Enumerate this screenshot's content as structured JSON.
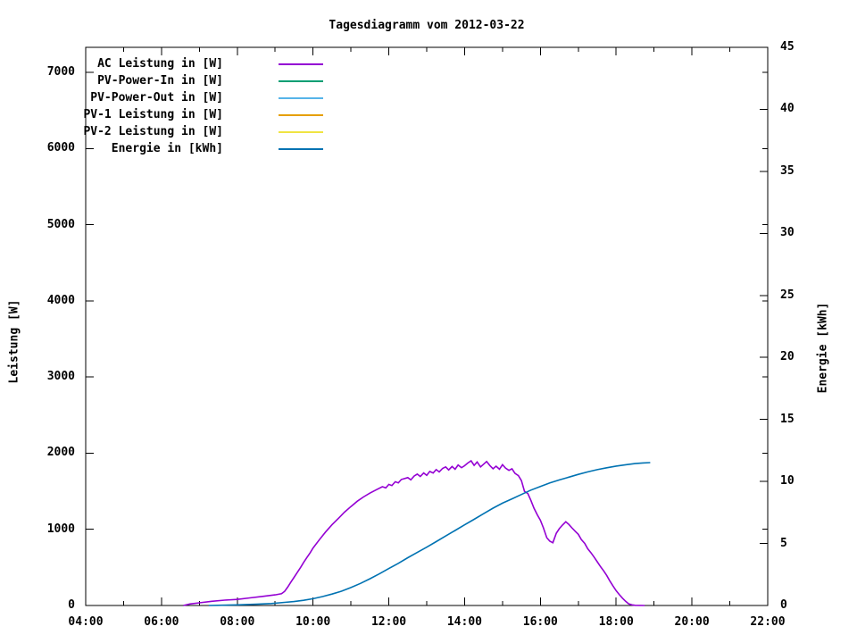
{
  "title": "Tagesdiagramm vom 2012-03-22",
  "axes": {
    "left": {
      "label": "Leistung [W]",
      "tick_values": [
        0,
        1000,
        2000,
        3000,
        4000,
        5000,
        6000,
        7000
      ],
      "range": [
        0,
        7330
      ]
    },
    "right": {
      "label": "Energie [kWh]",
      "tick_values": [
        0,
        5,
        10,
        15,
        20,
        25,
        30,
        35,
        40,
        45
      ],
      "range": [
        0,
        45
      ]
    },
    "x": {
      "major_tick_labels": [
        "04:00",
        "06:00",
        "08:00",
        "10:00",
        "12:00",
        "14:00",
        "16:00",
        "18:00",
        "20:00",
        "22:00"
      ],
      "range_hours": [
        4,
        22
      ],
      "minor_tick_every_hours": 1,
      "major_tick_every_hours": 2
    }
  },
  "legend": {
    "position": "top-left-inside",
    "items": [
      {
        "label": "AC Leistung in [W]",
        "color": "#9400d3"
      },
      {
        "label": "PV-Power-In in [W]",
        "color": "#009e73"
      },
      {
        "label": "PV-Power-Out in [W]",
        "color": "#56b4e9"
      },
      {
        "label": "PV-1 Leistung in [W]",
        "color": "#e69f00"
      },
      {
        "label": "PV-2 Leistung in [W]",
        "color": "#f0e442"
      },
      {
        "label": "Energie in [kWh]",
        "color": "#0072b2"
      }
    ]
  },
  "colors": {
    "foreground": "#000000",
    "background": "#ffffff"
  },
  "chart_data": {
    "type": "line",
    "title": "Tagesdiagramm vom 2012-03-22",
    "xlabel": "",
    "ylabel": "Leistung [W]",
    "y2label": "Energie [kWh]",
    "xlim_hours": [
      4,
      22
    ],
    "ylim": [
      0,
      7330
    ],
    "y2lim": [
      0,
      45
    ],
    "grid": false,
    "legend_position": "top-left",
    "x_unit": "time-of-day",
    "series": [
      {
        "name": "AC Leistung in [W]",
        "axis": "left",
        "color": "#9400d3",
        "points": [
          [
            6.58,
            0
          ],
          [
            6.75,
            20
          ],
          [
            7.0,
            35
          ],
          [
            7.33,
            55
          ],
          [
            7.67,
            70
          ],
          [
            8.0,
            80
          ],
          [
            8.33,
            100
          ],
          [
            8.67,
            120
          ],
          [
            9.0,
            140
          ],
          [
            9.17,
            155
          ],
          [
            9.25,
            185
          ],
          [
            9.33,
            240
          ],
          [
            9.42,
            310
          ],
          [
            9.5,
            370
          ],
          [
            9.58,
            430
          ],
          [
            9.67,
            500
          ],
          [
            9.75,
            565
          ],
          [
            9.83,
            625
          ],
          [
            9.92,
            690
          ],
          [
            10.0,
            755
          ],
          [
            10.17,
            865
          ],
          [
            10.33,
            965
          ],
          [
            10.5,
            1060
          ],
          [
            10.67,
            1145
          ],
          [
            10.83,
            1225
          ],
          [
            11.0,
            1300
          ],
          [
            11.17,
            1370
          ],
          [
            11.33,
            1425
          ],
          [
            11.5,
            1475
          ],
          [
            11.67,
            1520
          ],
          [
            11.83,
            1560
          ],
          [
            11.92,
            1545
          ],
          [
            12.0,
            1590
          ],
          [
            12.08,
            1575
          ],
          [
            12.17,
            1625
          ],
          [
            12.25,
            1610
          ],
          [
            12.33,
            1655
          ],
          [
            12.5,
            1680
          ],
          [
            12.58,
            1650
          ],
          [
            12.67,
            1700
          ],
          [
            12.75,
            1725
          ],
          [
            12.83,
            1695
          ],
          [
            12.92,
            1740
          ],
          [
            13.0,
            1710
          ],
          [
            13.08,
            1760
          ],
          [
            13.17,
            1740
          ],
          [
            13.25,
            1785
          ],
          [
            13.33,
            1755
          ],
          [
            13.42,
            1800
          ],
          [
            13.5,
            1820
          ],
          [
            13.58,
            1780
          ],
          [
            13.67,
            1825
          ],
          [
            13.75,
            1790
          ],
          [
            13.83,
            1845
          ],
          [
            13.92,
            1810
          ],
          [
            14.0,
            1835
          ],
          [
            14.08,
            1870
          ],
          [
            14.17,
            1900
          ],
          [
            14.25,
            1840
          ],
          [
            14.33,
            1885
          ],
          [
            14.42,
            1820
          ],
          [
            14.5,
            1855
          ],
          [
            14.58,
            1890
          ],
          [
            14.67,
            1835
          ],
          [
            14.75,
            1795
          ],
          [
            14.83,
            1830
          ],
          [
            14.92,
            1790
          ],
          [
            15.0,
            1850
          ],
          [
            15.08,
            1805
          ],
          [
            15.17,
            1775
          ],
          [
            15.25,
            1795
          ],
          [
            15.33,
            1735
          ],
          [
            15.42,
            1705
          ],
          [
            15.5,
            1640
          ],
          [
            15.58,
            1500
          ],
          [
            15.67,
            1470
          ],
          [
            15.75,
            1380
          ],
          [
            15.83,
            1280
          ],
          [
            15.92,
            1190
          ],
          [
            16.0,
            1120
          ],
          [
            16.08,
            1020
          ],
          [
            16.17,
            890
          ],
          [
            16.25,
            845
          ],
          [
            16.33,
            825
          ],
          [
            16.42,
            950
          ],
          [
            16.5,
            1010
          ],
          [
            16.58,
            1055
          ],
          [
            16.67,
            1100
          ],
          [
            16.75,
            1065
          ],
          [
            16.83,
            1020
          ],
          [
            16.92,
            975
          ],
          [
            17.0,
            935
          ],
          [
            17.08,
            865
          ],
          [
            17.17,
            815
          ],
          [
            17.25,
            745
          ],
          [
            17.33,
            695
          ],
          [
            17.42,
            635
          ],
          [
            17.5,
            575
          ],
          [
            17.58,
            515
          ],
          [
            17.67,
            455
          ],
          [
            17.75,
            395
          ],
          [
            17.83,
            325
          ],
          [
            17.92,
            255
          ],
          [
            18.0,
            195
          ],
          [
            18.08,
            145
          ],
          [
            18.17,
            95
          ],
          [
            18.25,
            55
          ],
          [
            18.33,
            22
          ],
          [
            18.42,
            8
          ],
          [
            18.5,
            2
          ],
          [
            18.75,
            0
          ]
        ]
      },
      {
        "name": "PV-Power-In in [W]",
        "axis": "left",
        "color": "#009e73",
        "points": []
      },
      {
        "name": "PV-Power-Out in [W]",
        "axis": "left",
        "color": "#56b4e9",
        "points": []
      },
      {
        "name": "PV-1 Leistung in [W]",
        "axis": "left",
        "color": "#e69f00",
        "points": []
      },
      {
        "name": "PV-2 Leistung in [W]",
        "axis": "left",
        "color": "#f0e442",
        "points": []
      },
      {
        "name": "Energie in [kWh]",
        "axis": "right",
        "color": "#0072b2",
        "points": [
          [
            7.25,
            0
          ],
          [
            7.6,
            0.02
          ],
          [
            8.0,
            0.05
          ],
          [
            8.5,
            0.1
          ],
          [
            8.9,
            0.16
          ],
          [
            9.25,
            0.25
          ],
          [
            9.5,
            0.32
          ],
          [
            9.75,
            0.42
          ],
          [
            10.0,
            0.55
          ],
          [
            10.25,
            0.72
          ],
          [
            10.5,
            0.92
          ],
          [
            10.75,
            1.15
          ],
          [
            11.0,
            1.45
          ],
          [
            11.25,
            1.78
          ],
          [
            11.5,
            2.15
          ],
          [
            11.75,
            2.55
          ],
          [
            12.0,
            2.98
          ],
          [
            12.25,
            3.4
          ],
          [
            12.5,
            3.85
          ],
          [
            12.75,
            4.28
          ],
          [
            13.0,
            4.7
          ],
          [
            13.25,
            5.15
          ],
          [
            13.5,
            5.6
          ],
          [
            13.75,
            6.05
          ],
          [
            14.0,
            6.5
          ],
          [
            14.25,
            6.95
          ],
          [
            14.5,
            7.4
          ],
          [
            14.75,
            7.85
          ],
          [
            15.0,
            8.25
          ],
          [
            15.25,
            8.6
          ],
          [
            15.5,
            8.95
          ],
          [
            15.75,
            9.3
          ],
          [
            16.0,
            9.6
          ],
          [
            16.25,
            9.88
          ],
          [
            16.5,
            10.12
          ],
          [
            16.75,
            10.35
          ],
          [
            17.0,
            10.57
          ],
          [
            17.25,
            10.77
          ],
          [
            17.5,
            10.95
          ],
          [
            17.75,
            11.1
          ],
          [
            18.0,
            11.24
          ],
          [
            18.25,
            11.35
          ],
          [
            18.5,
            11.44
          ],
          [
            18.7,
            11.49
          ],
          [
            18.9,
            11.52
          ]
        ]
      }
    ]
  }
}
